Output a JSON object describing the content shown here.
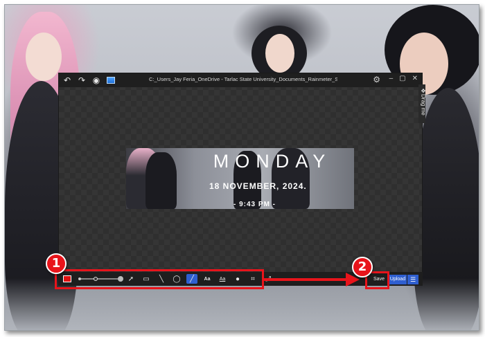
{
  "window": {
    "title": "C:_Users_Jay Feria_OneDrive - Tarlac State University_Documents_Rainmeter_Skins_N"
  },
  "titlebar_icons": [
    "undo-icon",
    "redo-icon",
    "camera-icon",
    "image-icon"
  ],
  "side_tab": {
    "label": "Drag me"
  },
  "preview": {
    "day": "MONDAY",
    "date": "18 NOVEMBER, 2024.",
    "time": "- 9:43 PM -"
  },
  "toolbar": {
    "color": "#e01010",
    "tools": [
      "arrow",
      "rectangle",
      "line",
      "ellipse",
      "pen",
      "text",
      "text-outline",
      "blur",
      "crop",
      "resize"
    ],
    "text_label": "Aa",
    "text_outline_label": "Aa",
    "save_label": "Save",
    "upload_label": "Upload"
  },
  "annotations": {
    "badge_1": "1",
    "badge_2": "2",
    "accent": "#e8141b"
  }
}
